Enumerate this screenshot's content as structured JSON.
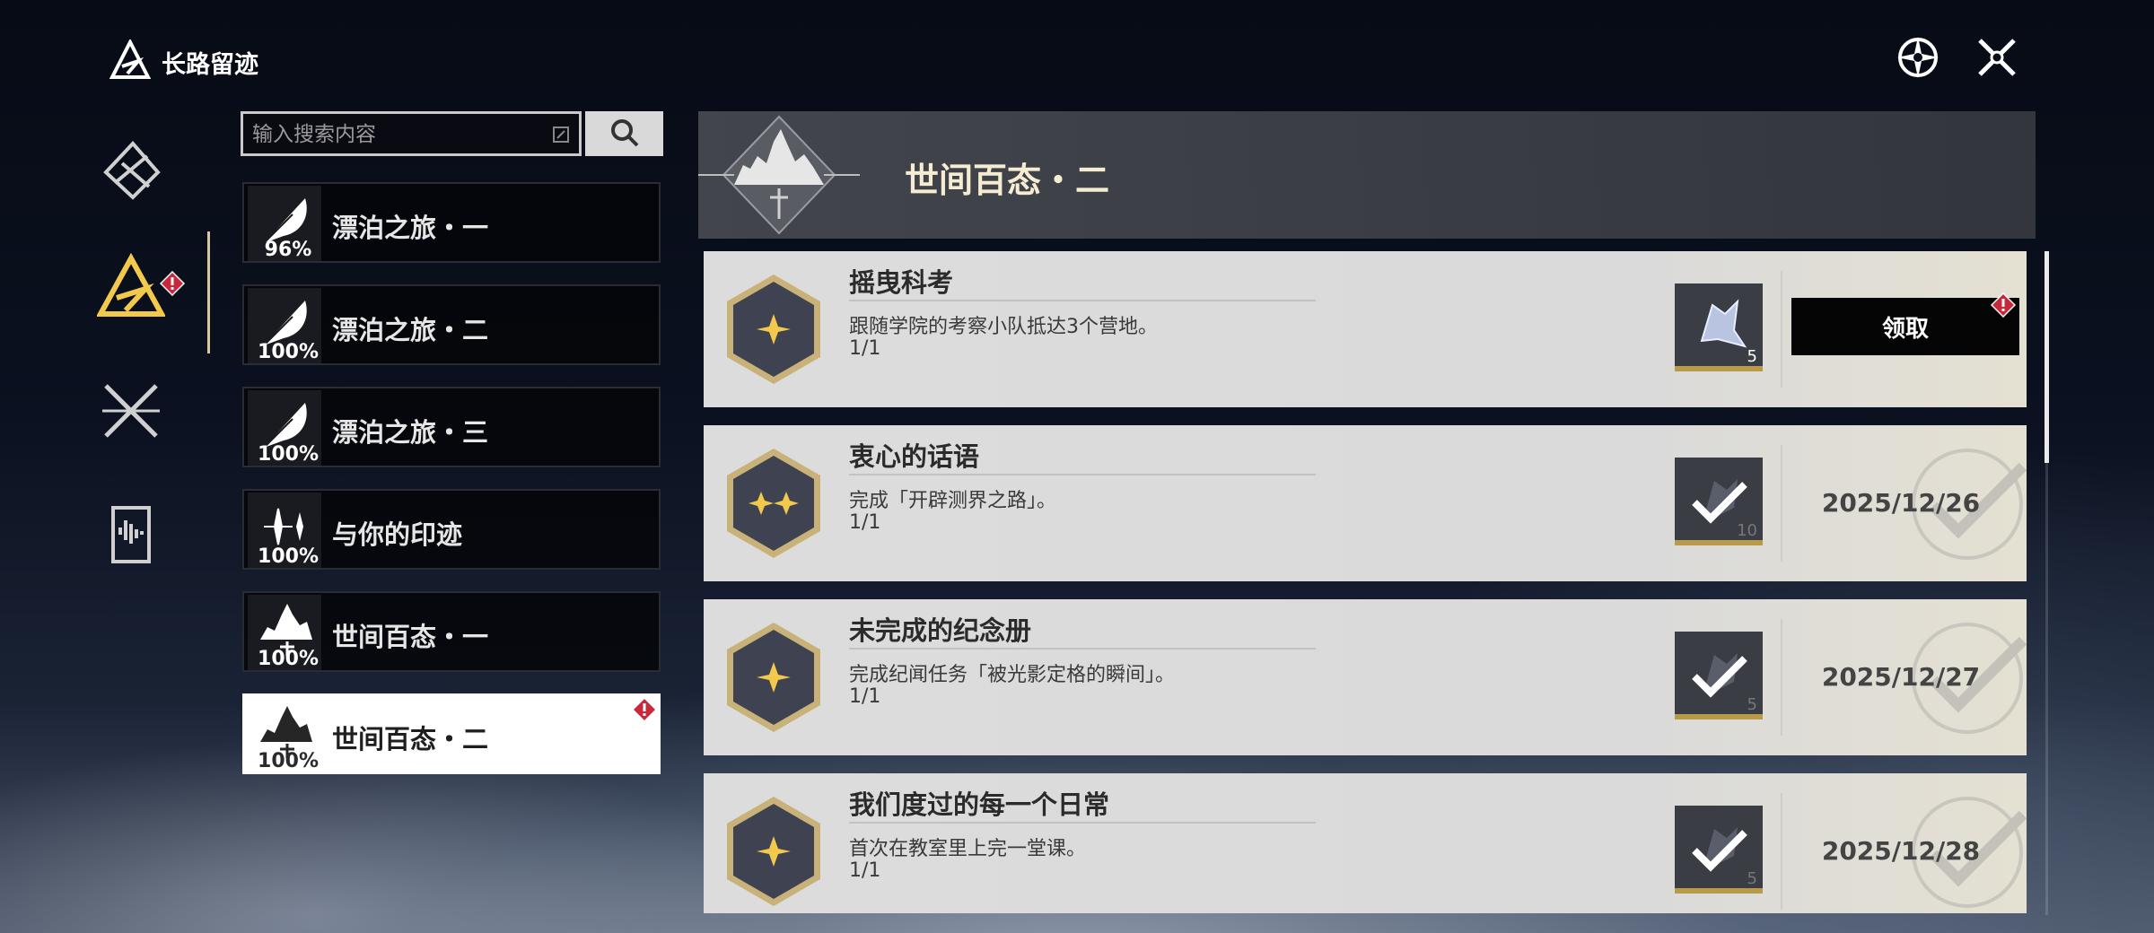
{
  "header": {
    "title": "长路留迹",
    "logo_icon": "path-triangle-logo-icon",
    "actions": [
      {
        "name": "compass-icon"
      },
      {
        "name": "close-icon"
      }
    ]
  },
  "rail": {
    "items": [
      {
        "icon": "shard-emblem-icon",
        "active": false
      },
      {
        "icon": "path-triangle-icon",
        "active": true,
        "alert": true
      },
      {
        "icon": "crossed-swords-icon",
        "active": false
      },
      {
        "icon": "waveform-card-icon",
        "active": false
      }
    ]
  },
  "search": {
    "placeholder": "输入搜索内容",
    "value": ""
  },
  "categories": [
    {
      "label": "漂泊之旅・一",
      "percent": "96%",
      "icon": "feather-icon"
    },
    {
      "label": "漂泊之旅・二",
      "percent": "100%",
      "icon": "feather-icon"
    },
    {
      "label": "漂泊之旅・三",
      "percent": "100%",
      "icon": "feather-icon"
    },
    {
      "label": "与你的印迹",
      "percent": "100%",
      "icon": "sparkles-icon"
    },
    {
      "label": "世间百态・一",
      "percent": "100%",
      "icon": "city-skyline-icon"
    },
    {
      "label": "世间百态・二",
      "percent": "100%",
      "icon": "city-skyline-icon",
      "selected": true,
      "alert": true
    }
  ],
  "banner": {
    "title": "世间百态・二",
    "icon": "city-skyline-emblem-icon"
  },
  "achievements": [
    {
      "title": "摇曳科考",
      "desc": "跟随学院的考察小队抵达3个营地。",
      "progress": "1/1",
      "stars": 1,
      "reward_count": "5",
      "status": "claimable",
      "claim_label": "领取"
    },
    {
      "title": "衷心的话语",
      "desc": "完成「开辟测界之路」。",
      "progress": "1/1",
      "stars": 2,
      "reward_count": "10",
      "status": "done",
      "date": "2025/12/26"
    },
    {
      "title": "未完成的纪念册",
      "desc": "完成纪闻任务「被光影定格的瞬间」。",
      "progress": "1/1",
      "stars": 1,
      "reward_count": "5",
      "status": "done",
      "date": "2025/12/27"
    },
    {
      "title": "我们度过的每一个日常",
      "desc": "首次在教室里上完一堂课。",
      "progress": "1/1",
      "stars": 1,
      "reward_count": "5",
      "status": "done",
      "date": "2025/12/28"
    }
  ],
  "colors": {
    "accent_gold": "#f2c94c",
    "alert_red": "#c8283c",
    "card_bg": "#dcdcdc",
    "selected_bg": "#ffffff"
  }
}
